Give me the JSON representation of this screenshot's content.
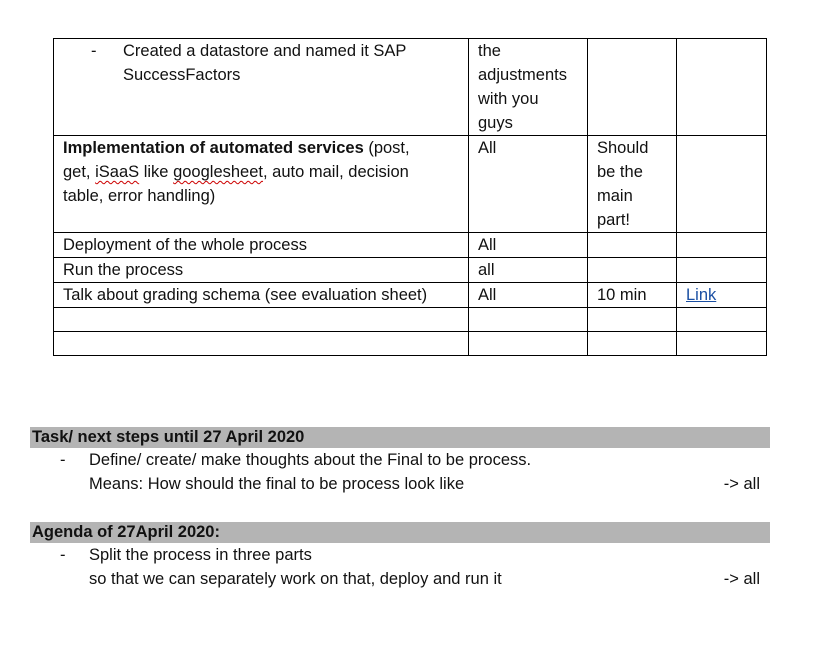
{
  "table": {
    "row1": {
      "bullet": "-",
      "line1": "Created a datastore and named it SAP",
      "line2": "SuccessFactors",
      "col2_lines": [
        "the",
        "adjustments",
        "with you",
        "guys"
      ],
      "col3": "",
      "col4": ""
    },
    "row2": {
      "bold": "Implementation of automated services",
      "rest1": " (post,",
      "line2_pre": "get, ",
      "line2_sq1": "iSaaS",
      "line2_mid": " like ",
      "line2_sq2": "googlesheet",
      "line2_post": ", auto mail, decision",
      "line3": "table, error handling)",
      "col2": "All",
      "col3_lines": [
        "Should",
        "be the",
        "main",
        "part!"
      ],
      "col4": ""
    },
    "row3": {
      "col1": "Deployment of the whole process",
      "col2": "All",
      "col3": "",
      "col4": ""
    },
    "row4": {
      "col1": "Run the process",
      "col2": "all",
      "col3": "",
      "col4": ""
    },
    "row5": {
      "col1": "Talk about grading schema (see evaluation sheet)",
      "col2": "All",
      "col3": "10 min",
      "col4": "Link"
    }
  },
  "tasks": {
    "header": "Task/ next steps until 27 April 2020",
    "bullet": "-",
    "line1": "Define/ create/ make thoughts about the Final to be process.",
    "line2": "Means: How should the final to be process look like",
    "assignee": "-> all"
  },
  "agenda": {
    "header": "Agenda of 27April 2020:",
    "bullet": "-",
    "line1": "Split the process in three parts",
    "line2": "so that we can separately work on that, deploy and run it",
    "assignee": "-> all"
  }
}
